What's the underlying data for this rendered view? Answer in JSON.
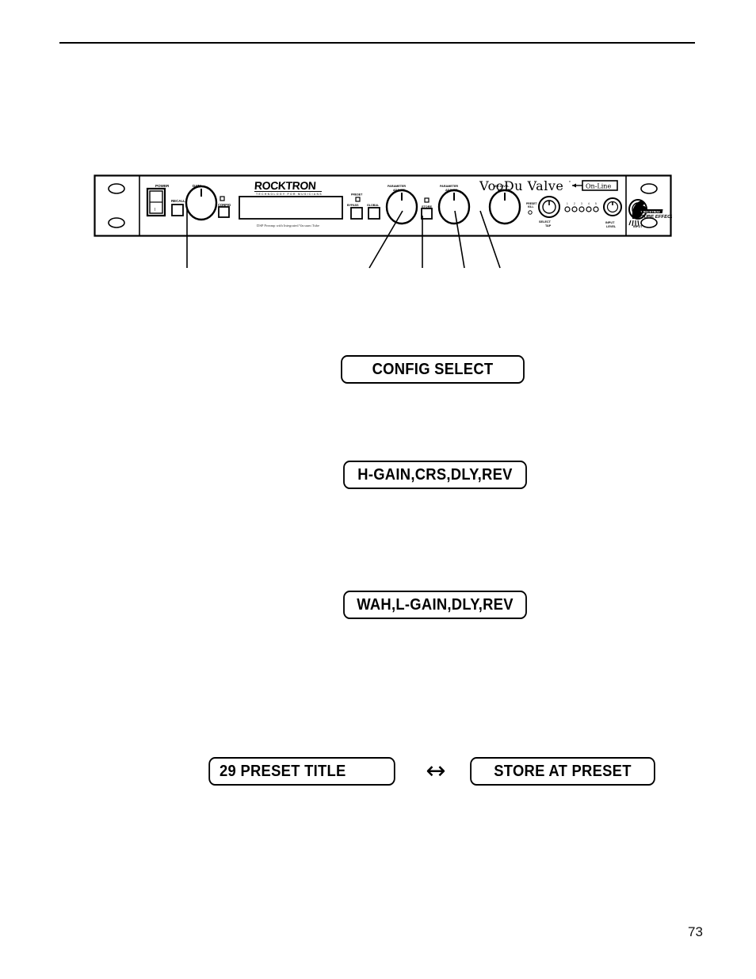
{
  "page": {
    "number": "73"
  },
  "device": {
    "brand": "ROCKTRON",
    "brand_tagline": "TECHNOLOGY FOR MUSICIANS",
    "model_name": "VooDu Valve",
    "online_badge": "On-Line",
    "subtitle": "DSP Preamp with Integrated Vacuum Tube",
    "sub_brand": "TUBE EFFECT",
    "controls": {
      "power_switch": "POWER",
      "data_knob": "DATA",
      "recall_button": "RECALL",
      "config_button": "CONFIG",
      "preset_bypass_button": "PRESET BYPASS",
      "global_bypass_button": "GLOBAL BYPASS",
      "param_adjust_knob_1": "PARAMETER ADJUST",
      "param_adjust_knob_2": "PARAMETER ADJUST",
      "store_button": "STORE",
      "mix_level_knob": "MIX LEVEL ADJUST",
      "select_tap_knob": "SELECT / TAP",
      "preset_kill_label": "PRESET KILL",
      "input_level_knob": "INPUT LEVEL",
      "input_jack": "INPUT",
      "led_meter": "1 2 3 4 5"
    }
  },
  "callouts": {
    "config_select": "CONFIG SELECT",
    "high_gain_chain": "H-GAIN,CRS,DLY,REV",
    "wah_chain": "WAH,L-GAIN,DLY,REV",
    "preset_title": "29 PRESET TITLE",
    "store_at_preset": "STORE AT PRESET",
    "swap_arrow": "↔"
  }
}
